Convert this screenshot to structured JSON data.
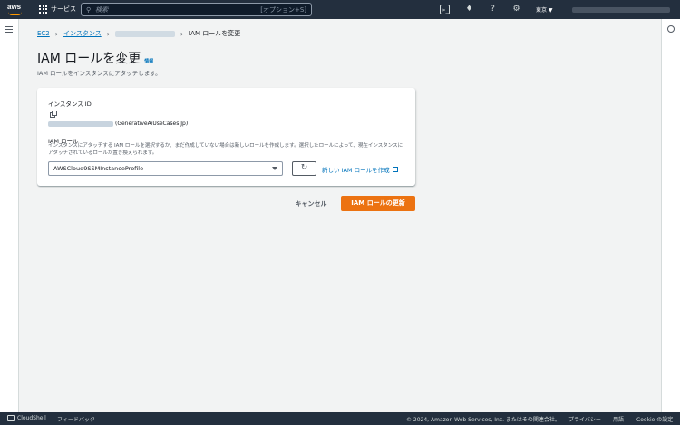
{
  "topnav": {
    "logo_text": "aws",
    "services_label": "サービス",
    "search_placeholder": "検索",
    "search_shortcut": "[オプション+S]",
    "region": "東京 ▼"
  },
  "breadcrumb": {
    "items": [
      "EC2",
      "インスタンス"
    ],
    "current": "IAM ロールを変更"
  },
  "page": {
    "title": "IAM ロールを変更",
    "info_link": "情報",
    "subtitle": "IAM ロールをインスタンスにアタッチします。"
  },
  "form": {
    "instance_id_label": "インスタンス ID",
    "instance_name": "(GenerativeAiUseCases.Jp)",
    "iam_role_label": "IAM ロール",
    "iam_role_description": "インスタンスにアタッチする IAM ロールを選択するか、まだ作成していない場合は新しいロールを作成します。選択したロールによって、現在インスタンスにアタッチされているロールが置き換えられます。",
    "iam_role_value": "AWSCloud9SSMInstanceProfile",
    "create_role_link": "新しい IAM ロールを作成"
  },
  "actions": {
    "cancel": "キャンセル",
    "update": "IAM ロールの更新"
  },
  "footer": {
    "cloudshell": "CloudShell",
    "feedback": "フィードバック",
    "copyright": "© 2024, Amazon Web Services, Inc. またはその関連会社。",
    "privacy": "プライバシー",
    "terms": "用語",
    "cookie": "Cookie の設定"
  },
  "colors": {
    "nav_bg": "#232f3e",
    "primary_button": "#ec7211",
    "link": "#0073bb"
  }
}
